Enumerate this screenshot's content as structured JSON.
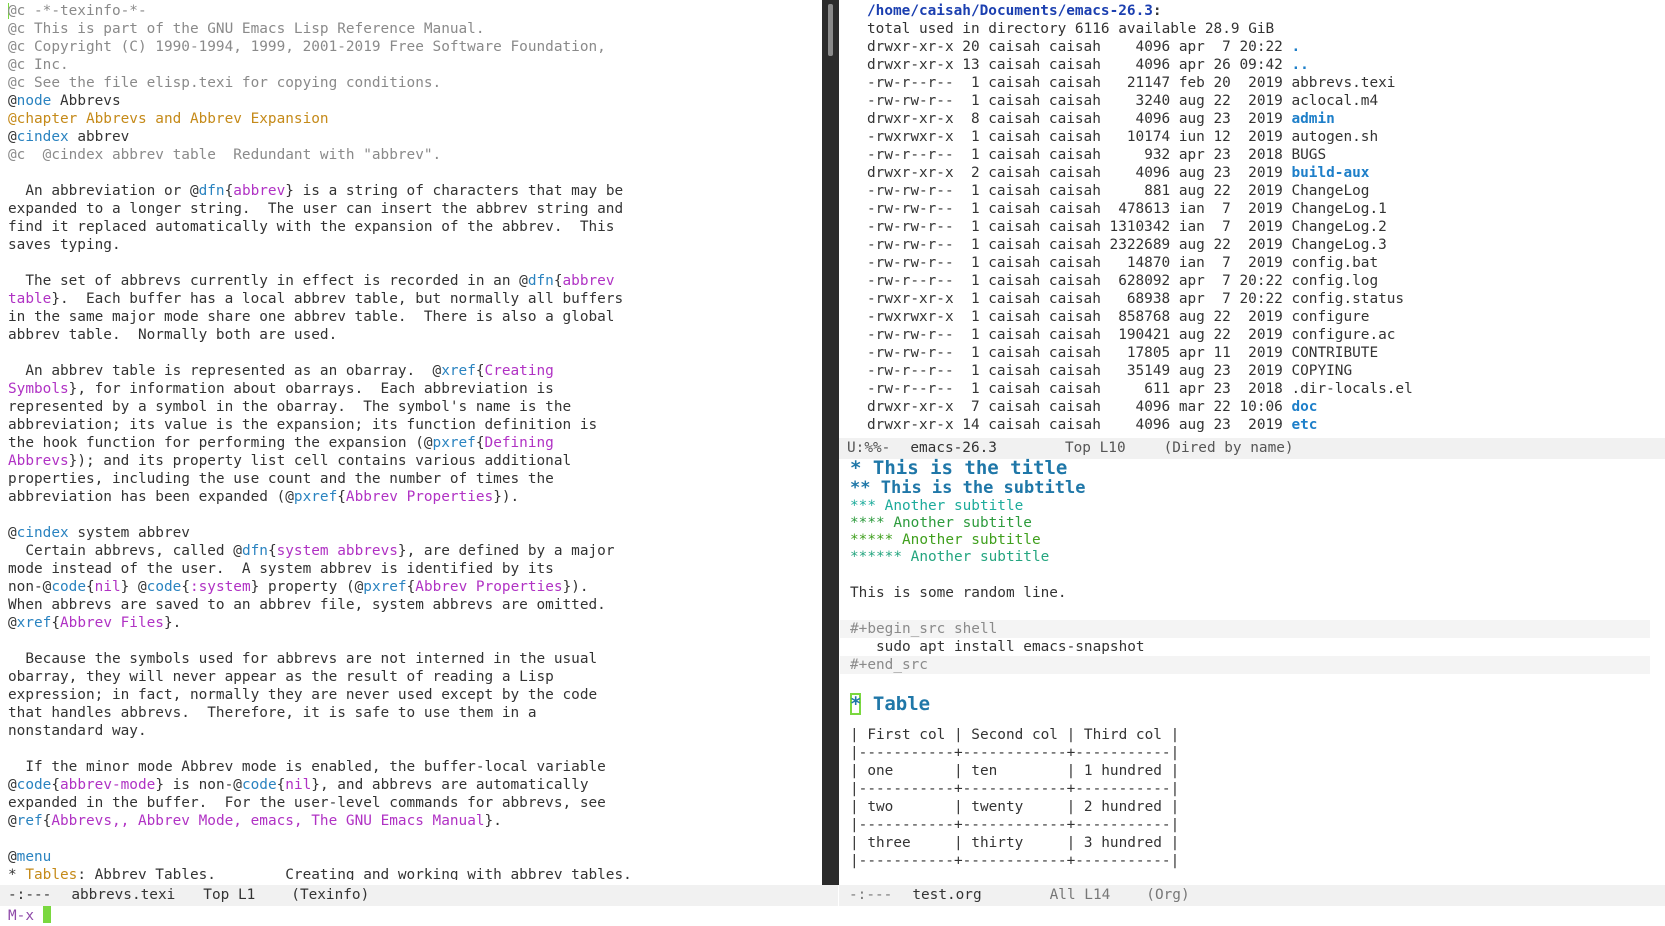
{
  "colors": {
    "keyword": "#2a83c0",
    "argument": "#b032c4",
    "comment": "#8a8a8a",
    "chapter": "#c58a19",
    "text": "#333333",
    "dir_header": "#1b3fb0",
    "dir_name": "#1e7fc9",
    "org_h1": "#1f77a8",
    "org_h2": "#1f77a8",
    "org_h3": "#1cab9b",
    "org_h4": "#2d9b3d",
    "org_h5": "#40a01e",
    "org_h6": "#24a57f",
    "cursor": "#7ad83f",
    "minibuffer": "#8f4aa9"
  },
  "left_buffer": {
    "lines": [
      [
        {
          "t": "@c -*-texinfo-*-",
          "s": "comment"
        }
      ],
      [
        {
          "t": "@c This is part of the GNU Emacs Lisp Reference Manual.",
          "s": "comment"
        }
      ],
      [
        {
          "t": "@c Copyright (C) 1990-1994, 1999, 2001-2019 Free Software Foundation,",
          "s": "comment"
        }
      ],
      [
        {
          "t": "@c Inc.",
          "s": "comment"
        }
      ],
      [
        {
          "t": "@c See the file elisp.texi for copying conditions.",
          "s": "comment"
        }
      ],
      [
        {
          "t": "@",
          "s": "text"
        },
        {
          "t": "node",
          "s": "keyword"
        },
        {
          "t": " Abbrevs",
          "s": "text"
        }
      ],
      [
        {
          "t": "@chapter Abbrevs and Abbrev Expansion",
          "s": "chapter"
        }
      ],
      [
        {
          "t": "@",
          "s": "text"
        },
        {
          "t": "cindex",
          "s": "keyword"
        },
        {
          "t": " abbrev",
          "s": "text"
        }
      ],
      [
        {
          "t": "@c  @cindex abbrev table  Redundant with \"abbrev\".",
          "s": "comment"
        }
      ],
      [
        {
          "t": "",
          "s": "text"
        }
      ],
      [
        {
          "t": "  An abbreviation or @",
          "s": "text"
        },
        {
          "t": "dfn",
          "s": "keyword"
        },
        {
          "t": "{",
          "s": "text"
        },
        {
          "t": "abbrev",
          "s": "argument"
        },
        {
          "t": "} is a string of characters that may be",
          "s": "text"
        }
      ],
      [
        {
          "t": "expanded to a longer string.  The user can insert the abbrev string and",
          "s": "text"
        }
      ],
      [
        {
          "t": "find it replaced automatically with the expansion of the abbrev.  This",
          "s": "text"
        }
      ],
      [
        {
          "t": "saves typing.",
          "s": "text"
        }
      ],
      [
        {
          "t": "",
          "s": "text"
        }
      ],
      [
        {
          "t": "  The set of abbrevs currently in effect is recorded in an @",
          "s": "text"
        },
        {
          "t": "dfn",
          "s": "keyword"
        },
        {
          "t": "{",
          "s": "text"
        },
        {
          "t": "abbrev",
          "s": "argument"
        }
      ],
      [
        {
          "t": "table",
          "s": "argument"
        },
        {
          "t": "}.  Each buffer has a local abbrev table, but normally all buffers",
          "s": "text"
        }
      ],
      [
        {
          "t": "in the same major mode share one abbrev table.  There is also a global",
          "s": "text"
        }
      ],
      [
        {
          "t": "abbrev table.  Normally both are used.",
          "s": "text"
        }
      ],
      [
        {
          "t": "",
          "s": "text"
        }
      ],
      [
        {
          "t": "  An abbrev table is represented as an obarray.  @",
          "s": "text"
        },
        {
          "t": "xref",
          "s": "keyword"
        },
        {
          "t": "{",
          "s": "text"
        },
        {
          "t": "Creating",
          "s": "argument"
        }
      ],
      [
        {
          "t": "Symbols",
          "s": "argument"
        },
        {
          "t": "}, for information about obarrays.  Each abbreviation is",
          "s": "text"
        }
      ],
      [
        {
          "t": "represented by a symbol in the obarray.  The symbol's name is the",
          "s": "text"
        }
      ],
      [
        {
          "t": "abbreviation; its value is the expansion; its function definition is",
          "s": "text"
        }
      ],
      [
        {
          "t": "the hook function for performing the expansion (@",
          "s": "text"
        },
        {
          "t": "pxref",
          "s": "keyword"
        },
        {
          "t": "{",
          "s": "text"
        },
        {
          "t": "Defining",
          "s": "argument"
        }
      ],
      [
        {
          "t": "Abbrevs",
          "s": "argument"
        },
        {
          "t": "}); and its property list cell contains various additional",
          "s": "text"
        }
      ],
      [
        {
          "t": "properties, including the use count and the number of times the",
          "s": "text"
        }
      ],
      [
        {
          "t": "abbreviation has been expanded (@",
          "s": "text"
        },
        {
          "t": "pxref",
          "s": "keyword"
        },
        {
          "t": "{",
          "s": "text"
        },
        {
          "t": "Abbrev Properties",
          "s": "argument"
        },
        {
          "t": "}).",
          "s": "text"
        }
      ],
      [
        {
          "t": "",
          "s": "text"
        }
      ],
      [
        {
          "t": "@",
          "s": "text"
        },
        {
          "t": "cindex",
          "s": "keyword"
        },
        {
          "t": " system abbrev",
          "s": "text"
        }
      ],
      [
        {
          "t": "  Certain abbrevs, called @",
          "s": "text"
        },
        {
          "t": "dfn",
          "s": "keyword"
        },
        {
          "t": "{",
          "s": "text"
        },
        {
          "t": "system abbrevs",
          "s": "argument"
        },
        {
          "t": "}, are defined by a major",
          "s": "text"
        }
      ],
      [
        {
          "t": "mode instead of the user.  A system abbrev is identified by its",
          "s": "text"
        }
      ],
      [
        {
          "t": "non-@",
          "s": "text"
        },
        {
          "t": "code",
          "s": "keyword"
        },
        {
          "t": "{",
          "s": "text"
        },
        {
          "t": "nil",
          "s": "argument"
        },
        {
          "t": "} @",
          "s": "text"
        },
        {
          "t": "code",
          "s": "keyword"
        },
        {
          "t": "{",
          "s": "text"
        },
        {
          "t": ":system",
          "s": "argument"
        },
        {
          "t": "} property (@",
          "s": "text"
        },
        {
          "t": "pxref",
          "s": "keyword"
        },
        {
          "t": "{",
          "s": "text"
        },
        {
          "t": "Abbrev Properties",
          "s": "argument"
        },
        {
          "t": "}).",
          "s": "text"
        }
      ],
      [
        {
          "t": "When abbrevs are saved to an abbrev file, system abbrevs are omitted.",
          "s": "text"
        }
      ],
      [
        {
          "t": "@",
          "s": "text"
        },
        {
          "t": "xref",
          "s": "keyword"
        },
        {
          "t": "{",
          "s": "text"
        },
        {
          "t": "Abbrev Files",
          "s": "argument"
        },
        {
          "t": "}.",
          "s": "text"
        }
      ],
      [
        {
          "t": "",
          "s": "text"
        }
      ],
      [
        {
          "t": "  Because the symbols used for abbrevs are not interned in the usual",
          "s": "text"
        }
      ],
      [
        {
          "t": "obarray, they will never appear as the result of reading a Lisp",
          "s": "text"
        }
      ],
      [
        {
          "t": "expression; in fact, normally they are never used except by the code",
          "s": "text"
        }
      ],
      [
        {
          "t": "that handles abbrevs.  Therefore, it is safe to use them in a",
          "s": "text"
        }
      ],
      [
        {
          "t": "nonstandard way.",
          "s": "text"
        }
      ],
      [
        {
          "t": "",
          "s": "text"
        }
      ],
      [
        {
          "t": "  If the minor mode Abbrev mode is enabled, the buffer-local variable",
          "s": "text"
        }
      ],
      [
        {
          "t": "@",
          "s": "text"
        },
        {
          "t": "code",
          "s": "keyword"
        },
        {
          "t": "{",
          "s": "text"
        },
        {
          "t": "abbrev-mode",
          "s": "argument"
        },
        {
          "t": "} is non-@",
          "s": "text"
        },
        {
          "t": "code",
          "s": "keyword"
        },
        {
          "t": "{",
          "s": "text"
        },
        {
          "t": "nil",
          "s": "argument"
        },
        {
          "t": "}, and abbrevs are automatically",
          "s": "text"
        }
      ],
      [
        {
          "t": "expanded in the buffer.  For the user-level commands for abbrevs, see",
          "s": "text"
        }
      ],
      [
        {
          "t": "@",
          "s": "text"
        },
        {
          "t": "ref",
          "s": "keyword"
        },
        {
          "t": "{",
          "s": "text"
        },
        {
          "t": "Abbrevs,, Abbrev Mode, emacs, The GNU Emacs Manual",
          "s": "argument"
        },
        {
          "t": "}.",
          "s": "text"
        }
      ],
      [
        {
          "t": "",
          "s": "text"
        }
      ],
      [
        {
          "t": "@",
          "s": "text"
        },
        {
          "t": "menu",
          "s": "keyword"
        }
      ],
      [
        {
          "t": "* ",
          "s": "text"
        },
        {
          "t": "Tables",
          "s": "chapter"
        },
        {
          "t": ": Abbrev Tables.        Creating and working with abbrev tables.",
          "s": "text"
        }
      ]
    ]
  },
  "dired": {
    "header": "/home/caisah/Documents/emacs-26.3",
    "header_colon": ":",
    "summary": "total used in directory 6116 available 28.9 GiB",
    "entries": [
      {
        "perms": "drwxr-xr-x",
        "links": "20",
        "owner": "caisah",
        "group": "caisah",
        "size": "4096",
        "date": "apr  7 20:22",
        "name": ".",
        "dir": true
      },
      {
        "perms": "drwxr-xr-x",
        "links": "13",
        "owner": "caisah",
        "group": "caisah",
        "size": "4096",
        "date": "apr 26 09:42",
        "name": "..",
        "dir": true
      },
      {
        "perms": "-rw-r--r--",
        "links": "1",
        "owner": "caisah",
        "group": "caisah",
        "size": "21147",
        "date": "feb 20  2019",
        "name": "abbrevs.texi",
        "dir": false
      },
      {
        "perms": "-rw-rw-r--",
        "links": "1",
        "owner": "caisah",
        "group": "caisah",
        "size": "3240",
        "date": "aug 22  2019",
        "name": "aclocal.m4",
        "dir": false
      },
      {
        "perms": "drwxr-xr-x",
        "links": "8",
        "owner": "caisah",
        "group": "caisah",
        "size": "4096",
        "date": "aug 23  2019",
        "name": "admin",
        "dir": true
      },
      {
        "perms": "-rwxrwxr-x",
        "links": "1",
        "owner": "caisah",
        "group": "caisah",
        "size": "10174",
        "date": "iun 12  2019",
        "name": "autogen.sh",
        "dir": false
      },
      {
        "perms": "-rw-r--r--",
        "links": "1",
        "owner": "caisah",
        "group": "caisah",
        "size": "932",
        "date": "apr 23  2018",
        "name": "BUGS",
        "dir": false
      },
      {
        "perms": "drwxr-xr-x",
        "links": "2",
        "owner": "caisah",
        "group": "caisah",
        "size": "4096",
        "date": "aug 23  2019",
        "name": "build-aux",
        "dir": true
      },
      {
        "perms": "-rw-rw-r--",
        "links": "1",
        "owner": "caisah",
        "group": "caisah",
        "size": "881",
        "date": "aug 22  2019",
        "name": "ChangeLog",
        "dir": false
      },
      {
        "perms": "-rw-rw-r--",
        "links": "1",
        "owner": "caisah",
        "group": "caisah",
        "size": "478613",
        "date": "ian  7  2019",
        "name": "ChangeLog.1",
        "dir": false
      },
      {
        "perms": "-rw-rw-r--",
        "links": "1",
        "owner": "caisah",
        "group": "caisah",
        "size": "1310342",
        "date": "ian  7  2019",
        "name": "ChangeLog.2",
        "dir": false
      },
      {
        "perms": "-rw-rw-r--",
        "links": "1",
        "owner": "caisah",
        "group": "caisah",
        "size": "2322689",
        "date": "aug 22  2019",
        "name": "ChangeLog.3",
        "dir": false
      },
      {
        "perms": "-rw-rw-r--",
        "links": "1",
        "owner": "caisah",
        "group": "caisah",
        "size": "14870",
        "date": "ian  7  2019",
        "name": "config.bat",
        "dir": false
      },
      {
        "perms": "-rw-r--r--",
        "links": "1",
        "owner": "caisah",
        "group": "caisah",
        "size": "628092",
        "date": "apr  7 20:22",
        "name": "config.log",
        "dir": false
      },
      {
        "perms": "-rwxr-xr-x",
        "links": "1",
        "owner": "caisah",
        "group": "caisah",
        "size": "68938",
        "date": "apr  7 20:22",
        "name": "config.status",
        "dir": false
      },
      {
        "perms": "-rwxrwxr-x",
        "links": "1",
        "owner": "caisah",
        "group": "caisah",
        "size": "858768",
        "date": "aug 22  2019",
        "name": "configure",
        "dir": false
      },
      {
        "perms": "-rw-rw-r--",
        "links": "1",
        "owner": "caisah",
        "group": "caisah",
        "size": "190421",
        "date": "aug 22  2019",
        "name": "configure.ac",
        "dir": false
      },
      {
        "perms": "-rw-rw-r--",
        "links": "1",
        "owner": "caisah",
        "group": "caisah",
        "size": "17805",
        "date": "apr 11  2019",
        "name": "CONTRIBUTE",
        "dir": false
      },
      {
        "perms": "-rw-r--r--",
        "links": "1",
        "owner": "caisah",
        "group": "caisah",
        "size": "35149",
        "date": "aug 23  2019",
        "name": "COPYING",
        "dir": false
      },
      {
        "perms": "-rw-r--r--",
        "links": "1",
        "owner": "caisah",
        "group": "caisah",
        "size": "611",
        "date": "apr 23  2018",
        "name": ".dir-locals.el",
        "dir": false
      },
      {
        "perms": "drwxr-xr-x",
        "links": "7",
        "owner": "caisah",
        "group": "caisah",
        "size": "4096",
        "date": "mar 22 10:06",
        "name": "doc",
        "dir": true
      },
      {
        "perms": "drwxr-xr-x",
        "links": "14",
        "owner": "caisah",
        "group": "caisah",
        "size": "4096",
        "date": "aug 23  2019",
        "name": "etc",
        "dir": true
      }
    ]
  },
  "modeline_dired": {
    "status": "U:%%-",
    "buffer": "emacs-26.3",
    "position": "Top L10",
    "mode": "(Dired by name)"
  },
  "org": {
    "headings": [
      {
        "stars": "*",
        "text": "This is the title",
        "level": 1
      },
      {
        "stars": "**",
        "text": "This is the subtitle",
        "level": 2
      },
      {
        "stars": "***",
        "text": "Another subtitle",
        "level": 3
      },
      {
        "stars": "****",
        "text": "Another subtitle",
        "level": 4
      },
      {
        "stars": "*****",
        "text": "Another subtitle",
        "level": 5
      },
      {
        "stars": "******",
        "text": "Another subtitle",
        "level": 6
      }
    ],
    "random_line": "This is some random line.",
    "src_begin": "#+begin_src shell",
    "src_body": "   sudo apt install emacs-snapshot",
    "src_end": "#+end_src",
    "table_heading": {
      "stars": "*",
      "text": "Table"
    },
    "table_lines": [
      "| First col | Second col | Third col |",
      "|-----------+------------+-----------|",
      "| one       | ten        | 1 hundred |",
      "|-----------+------------+-----------|",
      "| two       | twenty     | 2 hundred |",
      "|-----------+------------+-----------|",
      "| three     | thirty     | 3 hundred |",
      "|-----------+------------+-----------|"
    ]
  },
  "modeline_left": {
    "status": "-:---",
    "buffer": "abbrevs.texi",
    "position": "Top L1",
    "mode": "(Texinfo)"
  },
  "modeline_org": {
    "status": "-:---",
    "buffer": "test.org",
    "position": "All L14",
    "mode": "(Org)"
  },
  "minibuffer": {
    "prompt": "M-x"
  }
}
